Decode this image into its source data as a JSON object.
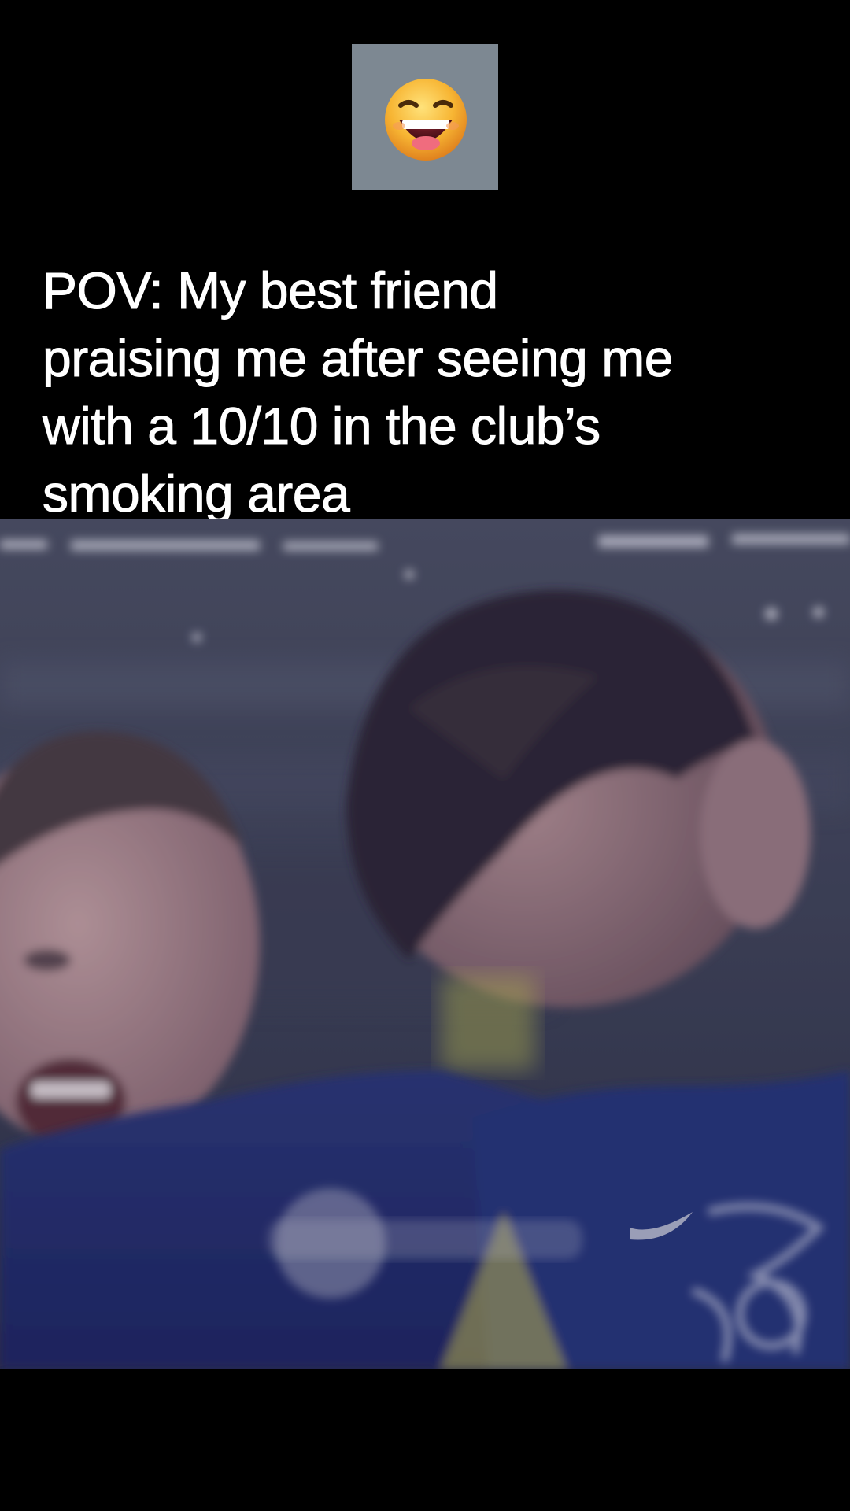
{
  "emoji": {
    "icon": "grinning-squinting-face-icon",
    "tile_color": "#7d8892"
  },
  "caption": {
    "lines": [
      "POV: My best friend",
      "praising me after seeing me",
      "with a 10/10 in the club’s",
      "smoking area"
    ],
    "color": "#ffffff"
  },
  "video": {
    "description_icon": "football-celebration-photo",
    "background": "#000000",
    "jersey_color": "#1c2a6e"
  }
}
